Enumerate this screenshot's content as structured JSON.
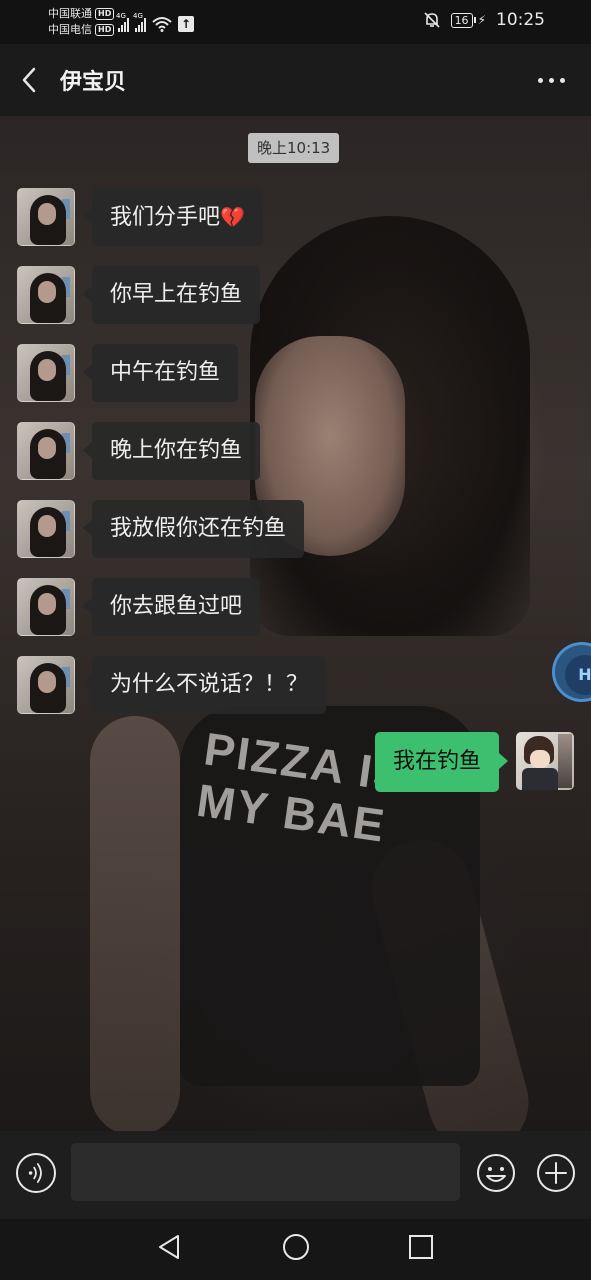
{
  "status_bar": {
    "carrier1": "中国联通",
    "carrier2": "中国电信",
    "hd": "HD",
    "net1": "4G",
    "net2": "4G",
    "battery": "16",
    "time": "10:25"
  },
  "header": {
    "title": "伊宝贝"
  },
  "background_print": {
    "line1": "PIZZA IS",
    "line2": "MY BAE"
  },
  "chat": {
    "timestamp": "晚上10:13",
    "messages": [
      {
        "side": "left",
        "text": "我们分手吧",
        "emoji": "💔"
      },
      {
        "side": "left",
        "text": "你早上在钓鱼"
      },
      {
        "side": "left",
        "text": "中午在钓鱼"
      },
      {
        "side": "left",
        "text": "晚上你在钓鱼"
      },
      {
        "side": "left",
        "text": "我放假你还在钓鱼"
      },
      {
        "side": "left",
        "text": "你去跟鱼过吧"
      },
      {
        "side": "left",
        "text": "为什么不说话？！？"
      },
      {
        "side": "right",
        "text": "我在钓鱼"
      }
    ]
  },
  "input_bar": {
    "value": ""
  },
  "floating_button": {
    "label": "H"
  },
  "icons": {
    "back": "chevron-left-icon",
    "more": "more-icon",
    "voice": "voice-icon",
    "emoji": "emoji-icon",
    "plus": "plus-icon",
    "nav_back": "triangle-back-icon",
    "nav_home": "circle-home-icon",
    "nav_recent": "square-recent-icon"
  },
  "colors": {
    "sent_bubble": "#3cbf6e",
    "received_bubble": "#282828",
    "background": "#111111"
  }
}
